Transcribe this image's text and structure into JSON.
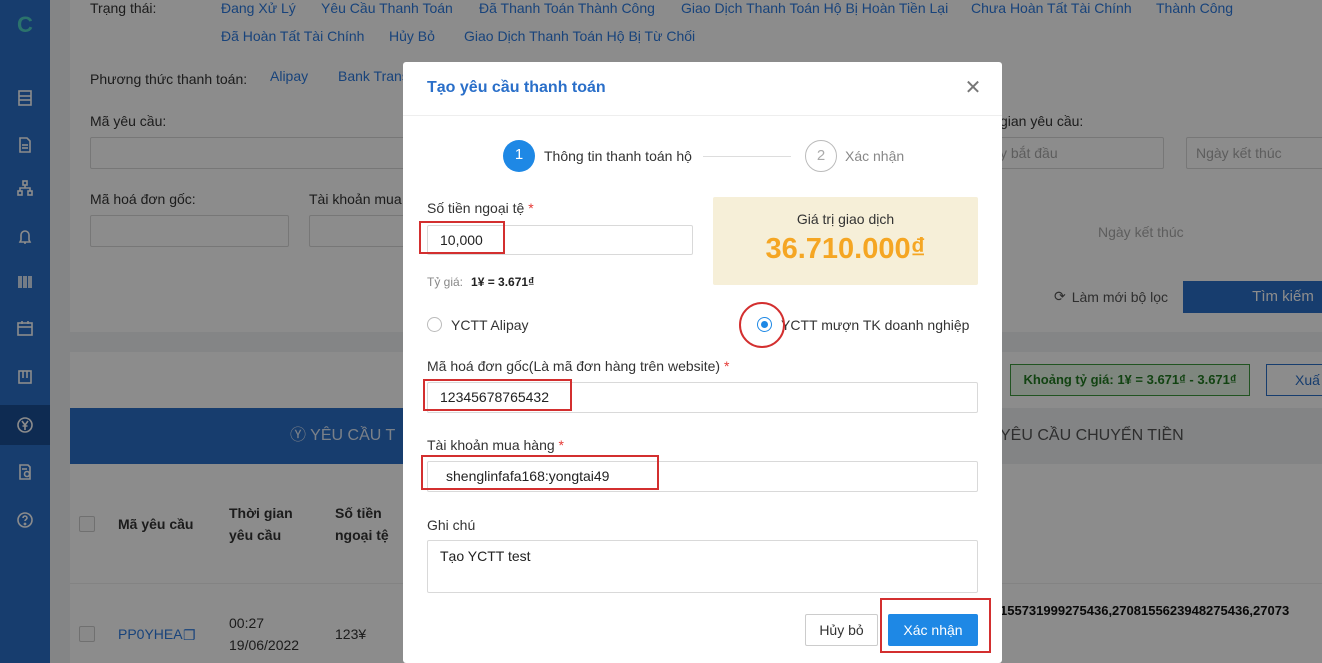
{
  "background": {
    "status_label": "Trạng thái:",
    "statuses": [
      "Đang Xử Lý",
      "Yêu Cầu Thanh Toán",
      "Đã Thanh Toán Thành Công",
      "Giao Dịch Thanh Toán Hộ Bị Hoàn Tiền Lại",
      "Chưa Hoàn Tất Tài Chính",
      "Thành Công",
      "Đã Hoàn Tất Tài Chính",
      "Hủy Bỏ",
      "Giao Dịch Thanh Toán Hộ Bị Từ Chối"
    ],
    "payment_method_label": "Phương thức thanh toán:",
    "payment_methods": [
      "Alipay",
      "Bank Trans"
    ],
    "request_code_label": "Mã yêu cầu:",
    "request_time_label": "gian yêu cầu:",
    "start_date_placeholder": "y bắt đầu",
    "end_date_placeholder": "Ngày kết thúc",
    "end_date_placeholder2": "Ngày kết thúc",
    "invoice_label": "Mã hoá đơn gốc:",
    "account_label": "Tài khoản mua",
    "reset_filter": "Làm mới bộ lọc",
    "search_button": "Tìm kiếm",
    "rate_range": "Khoảng tỷ giá: 1¥ = 3.671₫ - 3.671₫",
    "export_button": "Xuấ",
    "tab_payment": "YÊU CẦU T",
    "tab_transfer": "YÊU CẦU CHUYỂN TIỀN",
    "columns": [
      "Mã yêu cầu",
      "Thời gian yêu cầu",
      "Số tiền ngoại tệ"
    ],
    "row": {
      "code": "PP0YHEA",
      "time": "00:27",
      "date": "19/06/2022",
      "amount": "123¥",
      "ids": "155731999275436,270815562394827543​6,27073"
    }
  },
  "modal": {
    "title": "Tạo yêu cầu thanh toán",
    "steps": [
      {
        "number": "1",
        "label": "Thông tin thanh toán hộ"
      },
      {
        "number": "2",
        "label": "Xác nhận"
      }
    ],
    "foreign_amount_label": "Số tiền ngoại tệ",
    "foreign_amount_value": "10,000",
    "exchange_rate_label": "Tỷ giá:",
    "exchange_rate_value": "1¥ = 3.671₫",
    "transaction_value_label": "Giá trị giao dịch",
    "transaction_value": "36.710.000₫",
    "radio_alipay": "YCTT Alipay",
    "radio_business": "YCTT mượn TK doanh nghiệp",
    "invoice_label": "Mã hoá đơn gốc(Là mã đơn hàng trên website)",
    "invoice_value": "12345678765432",
    "account_label": "Tài khoản mua hàng",
    "account_value": "shenglinfafa168:yongtai49",
    "note_label": "Ghi chú",
    "note_value": "Tạo YCTT test",
    "required_mark": "*",
    "cancel_button": "Hủy bỏ",
    "confirm_button": "Xác nhận"
  },
  "colors": {
    "primary": "#1e88e5",
    "sidebar": "#2a6fc9",
    "amount": "#f5a623",
    "annotation": "#d32f2f"
  }
}
